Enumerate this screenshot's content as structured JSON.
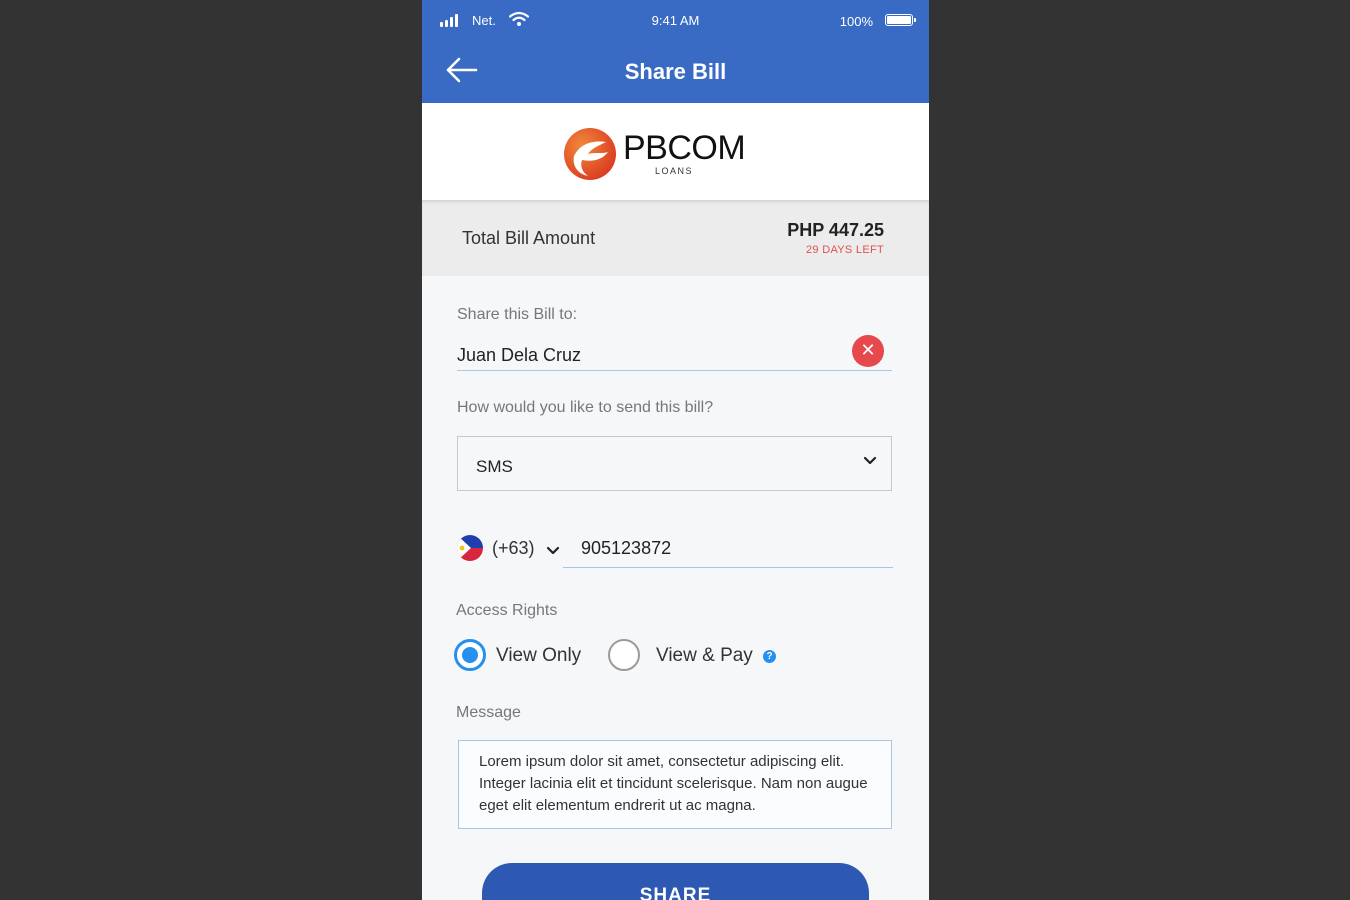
{
  "status_bar": {
    "carrier": "Net.",
    "time": "9:41 AM",
    "battery": "100%",
    "battery_level": 1.0
  },
  "header": {
    "title": "Share Bill",
    "back_icon": "arrow-left-icon"
  },
  "brand": {
    "name": "PBCOM",
    "subtitle": "LOANS",
    "logo_colors": [
      "#e8442b",
      "#f08a3a"
    ]
  },
  "bill": {
    "label": "Total Bill Amount",
    "amount": "PHP 447.25",
    "days_left": "29 DAYS LEFT"
  },
  "form": {
    "share_to_label": "Share this Bill to:",
    "share_to_value": "Juan Dela Cruz",
    "send_method_label": "How would you like to send this bill?",
    "send_method_value": "SMS",
    "country_code": "(+63)",
    "phone_number": "905123872",
    "access_label": "Access Rights",
    "access_options": [
      {
        "label": "View Only",
        "selected": true
      },
      {
        "label": "View & Pay",
        "selected": false
      }
    ],
    "help_icon": "?",
    "message_label": "Message",
    "message_value": "Lorem ipsum dolor sit amet, consectetur adipiscing elit. Integer lacinia elit et tincidunt scelerisque. Nam non augue eget elit elementum endrerit ut ac magna."
  },
  "actions": {
    "share_label": "SHARE"
  },
  "colors": {
    "header": "#3a6bc4",
    "accent": "#2590f0",
    "danger": "#e5484d",
    "button": "#2e59b2"
  }
}
